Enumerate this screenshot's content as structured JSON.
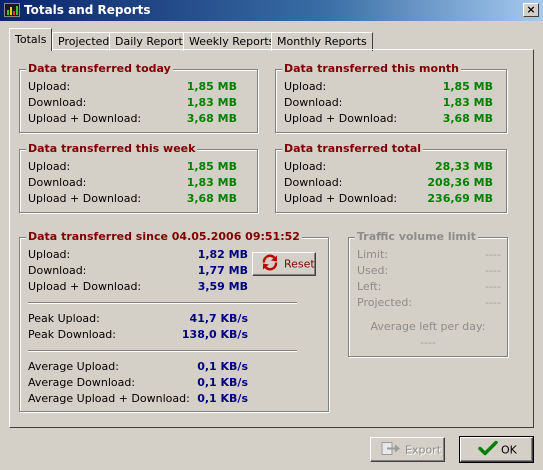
{
  "window": {
    "title": "Totals and Reports",
    "close": "×"
  },
  "tabs": [
    "Totals",
    "Projected",
    "Daily Reports",
    "Weekly Reports",
    "Monthly Reports"
  ],
  "labels": {
    "upload": "Upload:",
    "download": "Download:",
    "both": "Upload + Download:"
  },
  "today": {
    "title": "Data transferred today",
    "upload": "1,85 MB",
    "download": "1,83 MB",
    "total": "3,68 MB"
  },
  "month": {
    "title": "Data transferred this month",
    "upload": "1,85 MB",
    "download": "1,83 MB",
    "total": "3,68 MB"
  },
  "week": {
    "title": "Data transferred this week",
    "upload": "1,85 MB",
    "download": "1,83 MB",
    "total": "3,68 MB"
  },
  "total": {
    "title": "Data transferred total",
    "upload": "28,33 MB",
    "download": "208,36 MB",
    "total": "236,69 MB"
  },
  "since": {
    "title": "Data transferred since 04.05.2006 09:51:52",
    "upload": "1,82 MB",
    "download": "1,77 MB",
    "total": "3,59 MB",
    "peak_upload_label": "Peak Upload:",
    "peak_upload": "41,7 KB/s",
    "peak_download_label": "Peak Download:",
    "peak_download": "138,0 KB/s",
    "avg_upload_label": "Average Upload:",
    "avg_upload": "0,1 KB/s",
    "avg_download_label": "Average Download:",
    "avg_download": "0,1 KB/s",
    "avg_both_label": "Average Upload + Download:",
    "avg_both": "0,1 KB/s",
    "reset": "Reset"
  },
  "limit": {
    "title": "Traffic volume limit",
    "limit_label": "Limit:",
    "used_label": "Used:",
    "left_label": "Left:",
    "projected_label": "Projected:",
    "limit": "----",
    "used": "----",
    "left": "----",
    "projected": "----",
    "avg_left_label": "Average left per day:",
    "avg_left": "----"
  },
  "buttons": {
    "export": "Export",
    "ok": "OK"
  },
  "colors": {
    "titlebar": "#0a246a",
    "group_title": "#800000",
    "value_green": "#008000",
    "value_navy": "#000080",
    "face": "#d4d0c8"
  }
}
